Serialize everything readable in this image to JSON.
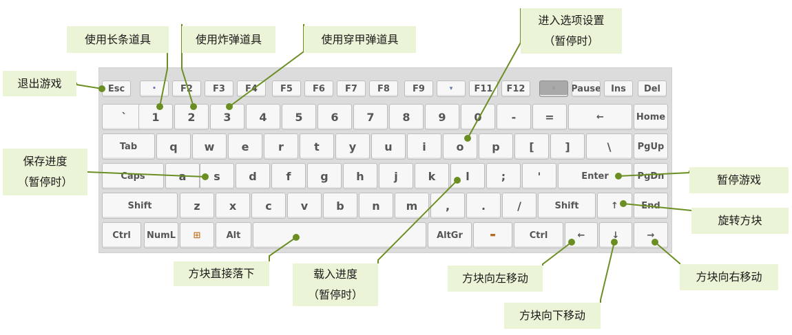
{
  "keyboard": {
    "row1": [
      "Esc",
      "•",
      "F2",
      "F3",
      "F4",
      "F5",
      "F6",
      "F7",
      "F8",
      "F9",
      "▾",
      "F11",
      "F12",
      "◦",
      "Pause",
      "Ins",
      "Del"
    ],
    "row2": [
      "`",
      "1",
      "2",
      "3",
      "4",
      "5",
      "6",
      "7",
      "8",
      "9",
      "0",
      "-",
      "=",
      "←",
      "Home"
    ],
    "row3": [
      "Tab",
      "q",
      "w",
      "e",
      "r",
      "t",
      "y",
      "u",
      "i",
      "o",
      "p",
      "[",
      "]",
      "\\",
      "PgUp"
    ],
    "row4": [
      "Caps",
      "a",
      "s",
      "d",
      "f",
      "g",
      "h",
      "j",
      "k",
      "l",
      ";",
      "'",
      "Enter",
      "PgDn"
    ],
    "row5": [
      "Shift",
      "z",
      "x",
      "c",
      "v",
      "b",
      "n",
      "m",
      ",",
      ".",
      "/",
      "Shift",
      "↑",
      "End"
    ],
    "row6": [
      "Ctrl",
      "NumL",
      "⊞",
      "Alt",
      "",
      "AltGr",
      "▬",
      "Ctrl",
      "←",
      "↓",
      "→"
    ]
  },
  "callouts": {
    "quit": "退出游戏",
    "long_bar": "使用长条道具",
    "bomb": "使用炸弹道具",
    "pierce": "使用穿甲弹道具",
    "options_line1": "进入选项设置",
    "options_line2": "（暂停时）",
    "save_line1": "保存进度",
    "save_line2": "（暂停时）",
    "pause": "暂停游戏",
    "rotate": "旋转方块",
    "drop": "方块直接落下",
    "load_line1": "载入进度",
    "load_line2": "（暂停时）",
    "left": "方块向左移动",
    "down": "方块向下移动",
    "right": "方块向右移动"
  },
  "colors": {
    "callout_bg": "#ebf4d6",
    "connector": "#6b8e23",
    "key_bg": "#f7f7f7",
    "frame_bg": "#dcdcdc"
  }
}
